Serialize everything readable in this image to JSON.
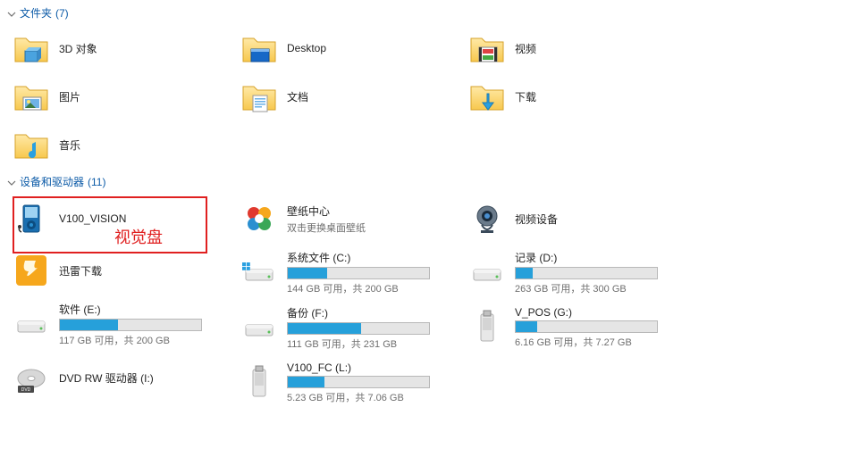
{
  "sections": {
    "folders": {
      "label": "文件夹",
      "count": "(7)"
    },
    "devices": {
      "label": "设备和驱动器",
      "count": "(11)"
    }
  },
  "folders": [
    {
      "name": "3D 对象",
      "icon": "3d"
    },
    {
      "name": "Desktop",
      "icon": "desktop"
    },
    {
      "name": "视频",
      "icon": "videos"
    },
    {
      "name": "图片",
      "icon": "pictures"
    },
    {
      "name": "文档",
      "icon": "documents"
    },
    {
      "name": "下载",
      "icon": "downloads"
    },
    {
      "name": "音乐",
      "icon": "music"
    }
  ],
  "devices": [
    {
      "name": "V100_VISION",
      "icon": "mp3",
      "type": "device"
    },
    {
      "name": "壁纸中心",
      "sub": "双击更换桌面壁纸",
      "icon": "wallpaper",
      "type": "app"
    },
    {
      "name": "视频设备",
      "icon": "webcam",
      "type": "device"
    },
    {
      "name": "迅雷下载",
      "icon": "thunder",
      "type": "app"
    },
    {
      "name": "系统文件 (C:)",
      "icon": "drive-win",
      "type": "drive",
      "free": "144 GB 可用，共 200 GB",
      "pct": 28
    },
    {
      "name": "记录 (D:)",
      "icon": "drive",
      "type": "drive",
      "free": "263 GB 可用，共 300 GB",
      "pct": 12
    },
    {
      "name": "软件 (E:)",
      "icon": "drive",
      "type": "drive",
      "free": "117 GB 可用，共 200 GB",
      "pct": 41
    },
    {
      "name": "备份 (F:)",
      "icon": "drive",
      "type": "drive",
      "free": "111 GB 可用，共 231 GB",
      "pct": 52
    },
    {
      "name": "V_POS (G:)",
      "icon": "usb",
      "type": "drive",
      "free": "6.16 GB 可用，共 7.27 GB",
      "pct": 15
    },
    {
      "name": "DVD RW 驱动器 (I:)",
      "icon": "dvd",
      "type": "device"
    },
    {
      "name": "V100_FC (L:)",
      "icon": "usb",
      "type": "drive",
      "free": "5.23 GB 可用，共 7.06 GB",
      "pct": 26
    }
  ],
  "annotation": "视觉盘"
}
